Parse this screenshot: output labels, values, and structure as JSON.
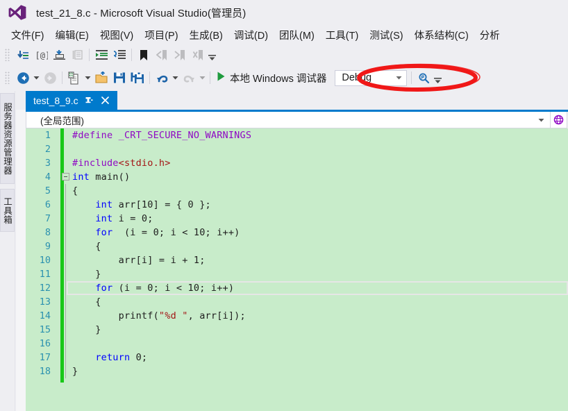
{
  "window": {
    "title": "test_21_8.c - Microsoft Visual Studio(管理员)",
    "logo_icon": "visual-studio-logo-icon",
    "accent_color": "#68217a",
    "tab_active_color": "#007acc"
  },
  "menubar": {
    "items": [
      {
        "label": "文件(F)"
      },
      {
        "label": "编辑(E)"
      },
      {
        "label": "视图(V)"
      },
      {
        "label": "项目(P)"
      },
      {
        "label": "生成(B)"
      },
      {
        "label": "调试(D)"
      },
      {
        "label": "团队(M)"
      },
      {
        "label": "工具(T)"
      },
      {
        "label": "测试(S)"
      },
      {
        "label": "体系结构(C)"
      },
      {
        "label": "分析"
      }
    ]
  },
  "toolbar_text_editor": {
    "grip_icon": "drag-grip-icon",
    "buttons": [
      {
        "icon": "insert-snippet-icon",
        "enabled": true
      },
      {
        "icon": "surround-with-icon",
        "enabled": true
      },
      {
        "icon": "comment-selection-icon",
        "enabled": true
      },
      {
        "icon": "uncomment-selection-icon",
        "enabled": false
      },
      {
        "icon": "increase-indent-icon",
        "enabled": true
      },
      {
        "icon": "decrease-indent-icon",
        "enabled": true
      },
      {
        "icon": "toggle-bookmark-icon",
        "enabled": true
      },
      {
        "icon": "previous-bookmark-icon",
        "enabled": false
      },
      {
        "icon": "next-bookmark-icon",
        "enabled": false
      },
      {
        "icon": "clear-bookmarks-icon",
        "enabled": false
      }
    ],
    "overflow_icon": "toolbar-overflow-icon"
  },
  "toolbar_standard": {
    "grip_icon": "drag-grip-icon",
    "buttons": [
      {
        "icon": "navigate-backward-icon",
        "enabled": true,
        "has_caret": true
      },
      {
        "icon": "navigate-forward-icon",
        "enabled": false,
        "has_caret": false
      },
      {
        "icon": "new-project-icon",
        "enabled": true,
        "has_caret": true
      },
      {
        "icon": "open-file-icon",
        "enabled": true,
        "has_caret": false
      },
      {
        "icon": "save-icon",
        "enabled": true,
        "has_caret": false
      },
      {
        "icon": "save-all-icon",
        "enabled": true,
        "has_caret": false
      },
      {
        "icon": "undo-icon",
        "enabled": true,
        "has_caret": true
      },
      {
        "icon": "redo-icon",
        "enabled": false,
        "has_caret": true
      }
    ],
    "run": {
      "play_icon": "start-debug-play-icon",
      "label": "本地 Windows 调试器"
    },
    "configuration": {
      "value": "Debug",
      "caret_icon": "chevron-down-icon"
    },
    "find_icon": "quick-launch-search-icon",
    "overflow_icon": "toolbar-overflow-icon"
  },
  "annotation": {
    "shape": "ellipse",
    "color": "#f01818",
    "target": "Debug"
  },
  "left_dock": {
    "tabs": [
      {
        "label": "服务器资源管理器"
      },
      {
        "label": "工具箱"
      }
    ]
  },
  "document": {
    "tab": {
      "name": "test_8_9.c",
      "pin_icon": "pin-tab-icon",
      "close_icon": "close-tab-icon"
    },
    "navigation_bar": {
      "scope": "(全局范围)",
      "caret_icon": "chevron-down-icon",
      "toggle_icon": "navigation-bar-toggle-icon"
    }
  },
  "editor": {
    "background_color": "#c8ecca",
    "change_bar_color": "#18c818",
    "linenumber_color": "#2b91af",
    "current_line": 12,
    "fold_line": 4,
    "lines": [
      {
        "n": "1",
        "tokens": [
          {
            "t": "#define ",
            "c": "pp"
          },
          {
            "t": "_CRT_SECURE_NO_WARNINGS",
            "c": "pp"
          }
        ]
      },
      {
        "n": "2",
        "tokens": []
      },
      {
        "n": "3",
        "tokens": [
          {
            "t": "#include",
            "c": "pp"
          },
          {
            "t": "<stdio.h>",
            "c": "inc"
          }
        ]
      },
      {
        "n": "4",
        "tokens": [
          {
            "t": "int",
            "c": "kw"
          },
          {
            "t": " main()",
            "c": ""
          }
        ]
      },
      {
        "n": "5",
        "tokens": [
          {
            "t": "{",
            "c": ""
          }
        ]
      },
      {
        "n": "6",
        "tokens": [
          {
            "t": "    ",
            "c": ""
          },
          {
            "t": "int",
            "c": "kw"
          },
          {
            "t": " arr[10] = { 0 };",
            "c": ""
          }
        ]
      },
      {
        "n": "7",
        "tokens": [
          {
            "t": "    ",
            "c": ""
          },
          {
            "t": "int",
            "c": "kw"
          },
          {
            "t": " i = 0;",
            "c": ""
          }
        ]
      },
      {
        "n": "8",
        "tokens": [
          {
            "t": "    ",
            "c": ""
          },
          {
            "t": "for",
            "c": "kw"
          },
          {
            "t": "  (i = 0; i < 10; i++)",
            "c": ""
          }
        ]
      },
      {
        "n": "9",
        "tokens": [
          {
            "t": "    {",
            "c": ""
          }
        ]
      },
      {
        "n": "10",
        "tokens": [
          {
            "t": "        arr[i] = i + 1;",
            "c": ""
          }
        ]
      },
      {
        "n": "11",
        "tokens": [
          {
            "t": "    }",
            "c": ""
          }
        ]
      },
      {
        "n": "12",
        "tokens": [
          {
            "t": "    ",
            "c": ""
          },
          {
            "t": "for",
            "c": "kw"
          },
          {
            "t": " (i = 0; i < 10; i++)",
            "c": ""
          }
        ]
      },
      {
        "n": "13",
        "tokens": [
          {
            "t": "    {",
            "c": ""
          }
        ]
      },
      {
        "n": "14",
        "tokens": [
          {
            "t": "        printf(",
            "c": ""
          },
          {
            "t": "\"%d \"",
            "c": "str"
          },
          {
            "t": ", arr[i]);",
            "c": ""
          }
        ]
      },
      {
        "n": "15",
        "tokens": [
          {
            "t": "    }",
            "c": ""
          }
        ]
      },
      {
        "n": "16",
        "tokens": []
      },
      {
        "n": "17",
        "tokens": [
          {
            "t": "    ",
            "c": ""
          },
          {
            "t": "return",
            "c": "kw"
          },
          {
            "t": " 0;",
            "c": ""
          }
        ]
      },
      {
        "n": "18",
        "tokens": [
          {
            "t": "}",
            "c": ""
          }
        ]
      }
    ]
  }
}
